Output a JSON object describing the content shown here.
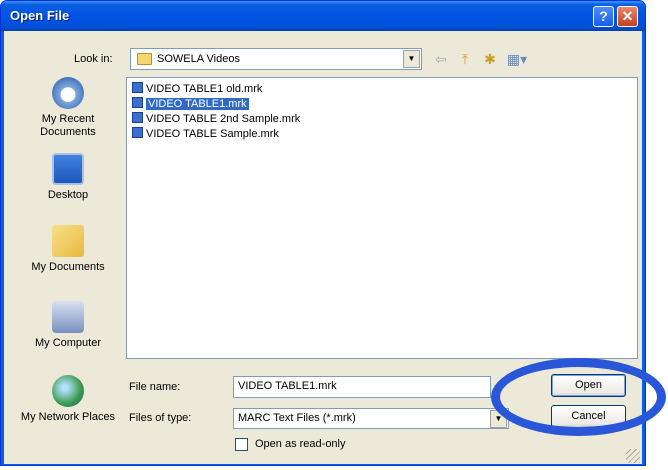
{
  "window": {
    "title": "Open File"
  },
  "toolbar": {
    "look_in_label": "Look in:",
    "look_in_value": "SOWELA Videos"
  },
  "places": [
    {
      "label": "My Recent Documents",
      "icon": "recent-documents-icon"
    },
    {
      "label": "Desktop",
      "icon": "desktop-icon"
    },
    {
      "label": "My Documents",
      "icon": "my-documents-icon"
    },
    {
      "label": "My Computer",
      "icon": "my-computer-icon"
    },
    {
      "label": "My Network Places",
      "icon": "network-places-icon"
    }
  ],
  "files": [
    {
      "name": "VIDEO TABLE1 old.mrk",
      "selected": false
    },
    {
      "name": "VIDEO TABLE1.mrk",
      "selected": true
    },
    {
      "name": "VIDEO TABLE 2nd Sample.mrk",
      "selected": false
    },
    {
      "name": "VIDEO TABLE Sample.mrk",
      "selected": false
    }
  ],
  "form": {
    "file_name_label": "File name:",
    "file_name_value": "VIDEO TABLE1.mrk",
    "file_type_label": "Files of type:",
    "file_type_value": "MARC Text Files (*.mrk)",
    "read_only_label": "Open as read-only"
  },
  "buttons": {
    "open": "Open",
    "cancel": "Cancel"
  },
  "colors": {
    "title_bar": "#0054e3",
    "selection": "#316ac5",
    "highlight_ellipse": "#2a56d8"
  }
}
